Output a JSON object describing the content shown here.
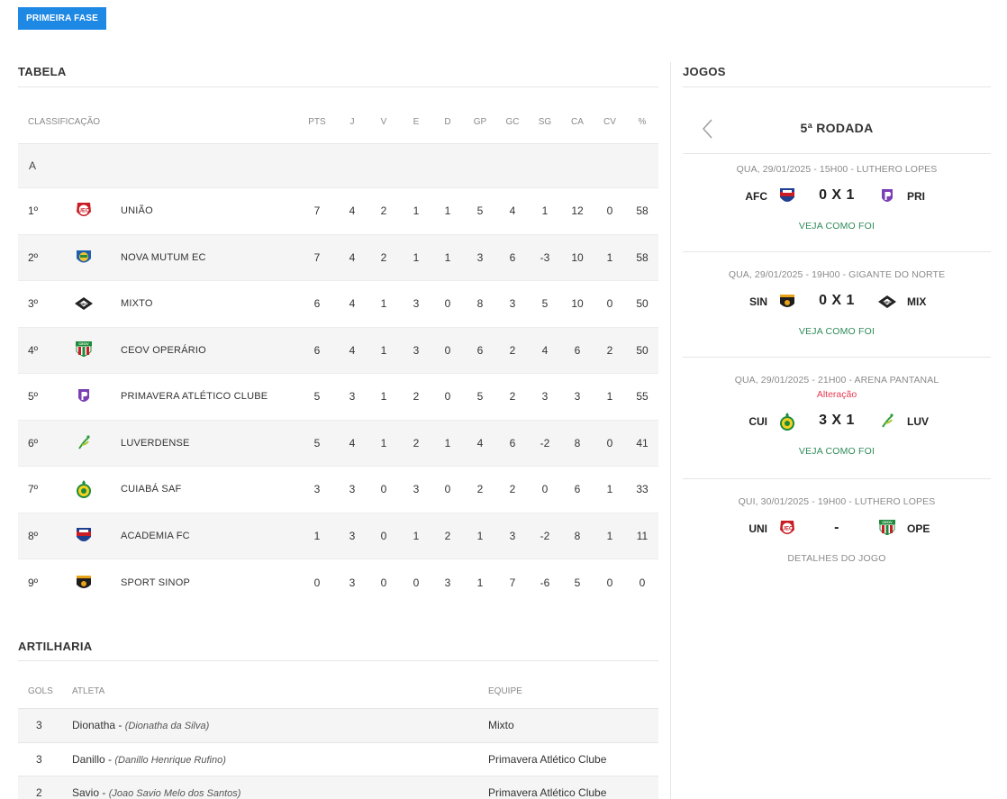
{
  "phase_button": "PRIMEIRA FASE",
  "tabela": {
    "title": "TABELA",
    "columns": {
      "classificacao": "CLASSIFICAÇÃO",
      "pts": "PTS",
      "j": "J",
      "v": "V",
      "e": "E",
      "d": "D",
      "gp": "GP",
      "gc": "GC",
      "sg": "SG",
      "ca": "CA",
      "cv": "CV",
      "pct": "%"
    },
    "group": "A",
    "rows": [
      {
        "pos": "1º",
        "team": "UNIÃO",
        "pts": "7",
        "j": "4",
        "v": "2",
        "e": "1",
        "d": "1",
        "gp": "5",
        "gc": "4",
        "sg": "1",
        "ca": "12",
        "cv": "0",
        "pct": "58"
      },
      {
        "pos": "2º",
        "team": "NOVA MUTUM EC",
        "pts": "7",
        "j": "4",
        "v": "2",
        "e": "1",
        "d": "1",
        "gp": "3",
        "gc": "6",
        "sg": "-3",
        "ca": "10",
        "cv": "1",
        "pct": "58"
      },
      {
        "pos": "3º",
        "team": "MIXTO",
        "pts": "6",
        "j": "4",
        "v": "1",
        "e": "3",
        "d": "0",
        "gp": "8",
        "gc": "3",
        "sg": "5",
        "ca": "10",
        "cv": "0",
        "pct": "50"
      },
      {
        "pos": "4º",
        "team": "CEOV OPERÁRIO",
        "pts": "6",
        "j": "4",
        "v": "1",
        "e": "3",
        "d": "0",
        "gp": "6",
        "gc": "2",
        "sg": "4",
        "ca": "6",
        "cv": "2",
        "pct": "50"
      },
      {
        "pos": "5º",
        "team": "PRIMAVERA ATLÉTICO CLUBE",
        "pts": "5",
        "j": "3",
        "v": "1",
        "e": "2",
        "d": "0",
        "gp": "5",
        "gc": "2",
        "sg": "3",
        "ca": "3",
        "cv": "1",
        "pct": "55"
      },
      {
        "pos": "6º",
        "team": "LUVERDENSE",
        "pts": "5",
        "j": "4",
        "v": "1",
        "e": "2",
        "d": "1",
        "gp": "4",
        "gc": "6",
        "sg": "-2",
        "ca": "8",
        "cv": "0",
        "pct": "41"
      },
      {
        "pos": "7º",
        "team": "CUIABÁ SAF",
        "pts": "3",
        "j": "3",
        "v": "0",
        "e": "3",
        "d": "0",
        "gp": "2",
        "gc": "2",
        "sg": "0",
        "ca": "6",
        "cv": "1",
        "pct": "33"
      },
      {
        "pos": "8º",
        "team": "ACADEMIA FC",
        "pts": "1",
        "j": "3",
        "v": "0",
        "e": "1",
        "d": "2",
        "gp": "1",
        "gc": "3",
        "sg": "-2",
        "ca": "8",
        "cv": "1",
        "pct": "11"
      },
      {
        "pos": "9º",
        "team": "SPORT SINOP",
        "pts": "0",
        "j": "3",
        "v": "0",
        "e": "0",
        "d": "3",
        "gp": "1",
        "gc": "7",
        "sg": "-6",
        "ca": "5",
        "cv": "0",
        "pct": "0"
      }
    ]
  },
  "artilharia": {
    "title": "ARTILHARIA",
    "columns": {
      "gols": "GOLS",
      "atleta": "ATLETA",
      "equipe": "EQUIPE"
    },
    "rows": [
      {
        "gols": "3",
        "name": "Dionatha",
        "full": "(Dionatha da Silva)",
        "team": "Mixto"
      },
      {
        "gols": "3",
        "name": "Danillo",
        "full": "(Danillo Henrique Rufino)",
        "team": "Primavera Atlético Clube"
      },
      {
        "gols": "2",
        "name": "Savio",
        "full": "(Joao Savio Melo dos Santos)",
        "team": "Primavera Atlético Clube"
      }
    ]
  },
  "jogos": {
    "title": "JOGOS",
    "round": "5ª RODADA",
    "matches": [
      {
        "info": "QUA, 29/01/2025 - 15H00 - LUTHERO LOPES",
        "alert": "",
        "home": "AFC",
        "away": "PRI",
        "score": "0 X 1",
        "link": "VEJA COMO FOI"
      },
      {
        "info": "QUA, 29/01/2025 - 19H00 - GIGANTE DO NORTE",
        "alert": "",
        "home": "SIN",
        "away": "MIX",
        "score": "0 X 1",
        "link": "VEJA COMO FOI"
      },
      {
        "info": "QUA, 29/01/2025 - 21H00 - ARENA PANTANAL",
        "alert": "Alteração",
        "home": "CUI",
        "away": "LUV",
        "score": "3 X 1",
        "link": "VEJA COMO FOI"
      },
      {
        "info": "QUI, 30/01/2025 - 19H00 - LUTHERO LOPES",
        "alert": "",
        "home": "UNI",
        "away": "OPE",
        "score": "-",
        "link": "DETALHES DO JOGO"
      }
    ]
  },
  "colors": {
    "accent": "#1e88e5",
    "link_green": "#2e8b57",
    "alert_red": "#e53950",
    "row_alt": "#f5f5f5"
  },
  "icons": {
    "uniao": "uniao-crest-icon",
    "nova_mutum": "nova-mutum-crest-icon",
    "mixto": "mixto-crest-icon",
    "ceov": "ceov-crest-icon",
    "primavera": "primavera-crest-icon",
    "luverdense": "luverdense-crest-icon",
    "cuiaba": "cuiaba-crest-icon",
    "academia": "academia-crest-icon",
    "sport_sinop": "sport-sinop-crest-icon",
    "prev": "chevron-left-icon"
  }
}
